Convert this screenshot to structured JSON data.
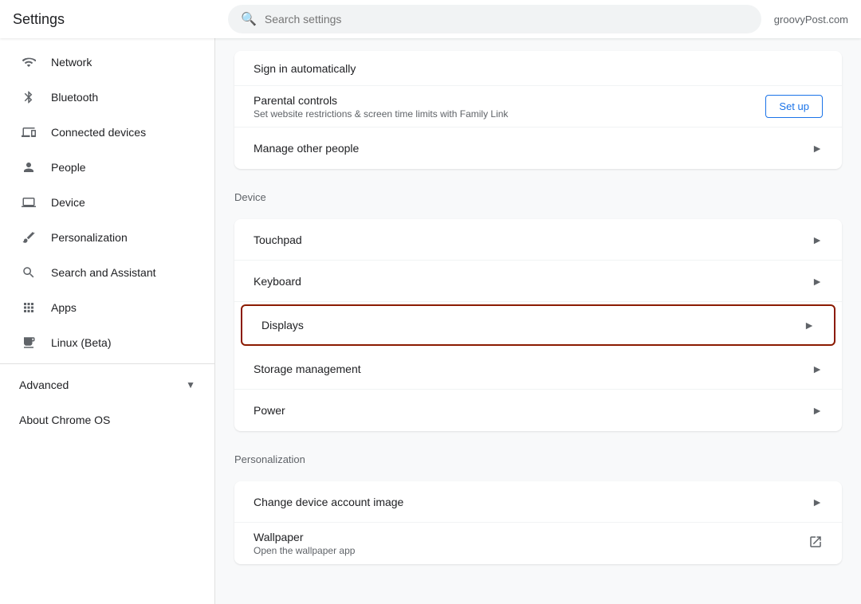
{
  "header": {
    "title": "Settings",
    "search_placeholder": "Search settings",
    "brand": "groovyPost.com"
  },
  "sidebar": {
    "items": [
      {
        "id": "network",
        "label": "Network",
        "icon": "wifi"
      },
      {
        "id": "bluetooth",
        "label": "Bluetooth",
        "icon": "bluetooth"
      },
      {
        "id": "connected-devices",
        "label": "Connected devices",
        "icon": "devices"
      },
      {
        "id": "people",
        "label": "People",
        "icon": "person"
      },
      {
        "id": "device",
        "label": "Device",
        "icon": "laptop"
      },
      {
        "id": "personalization",
        "label": "Personalization",
        "icon": "brush"
      },
      {
        "id": "search-assistant",
        "label": "Search and Assistant",
        "icon": "search"
      },
      {
        "id": "apps",
        "label": "Apps",
        "icon": "apps"
      },
      {
        "id": "linux",
        "label": "Linux (Beta)",
        "icon": "terminal"
      }
    ],
    "advanced_label": "Advanced",
    "about_label": "About Chrome OS"
  },
  "content": {
    "partial_item_label": "Sign in automatically",
    "people_section": {
      "items": [
        {
          "id": "parental-controls",
          "title": "Parental controls",
          "subtitle": "Set website restrictions & screen time limits with Family Link",
          "button_label": "Set up"
        },
        {
          "id": "manage-people",
          "title": "Manage other people",
          "has_chevron": true
        }
      ]
    },
    "device_section": {
      "title": "Device",
      "items": [
        {
          "id": "touchpad",
          "title": "Touchpad",
          "has_chevron": true
        },
        {
          "id": "keyboard",
          "title": "Keyboard",
          "has_chevron": true
        },
        {
          "id": "displays",
          "title": "Displays",
          "has_chevron": true,
          "highlighted": true
        },
        {
          "id": "storage-management",
          "title": "Storage management",
          "has_chevron": true
        },
        {
          "id": "power",
          "title": "Power",
          "has_chevron": true
        }
      ]
    },
    "personalization_section": {
      "title": "Personalization",
      "items": [
        {
          "id": "change-account-image",
          "title": "Change device account image",
          "has_chevron": true
        },
        {
          "id": "wallpaper",
          "title": "Wallpaper",
          "subtitle": "Open the wallpaper app",
          "has_external": true
        }
      ]
    }
  }
}
